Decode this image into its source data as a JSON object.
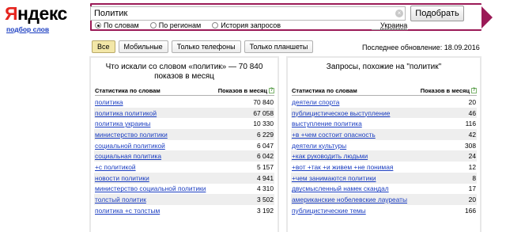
{
  "logo": {
    "first": "Я",
    "rest": "ндекс"
  },
  "subtitle": "подбор слов",
  "search": {
    "value": "Политик",
    "clear_glyph": "×",
    "button": "Подобрать",
    "icon": "close-icon"
  },
  "modes": [
    {
      "label": "По словам",
      "checked": true
    },
    {
      "label": "По регионам",
      "checked": false
    },
    {
      "label": "История запросов",
      "checked": false
    }
  ],
  "region": "Украина",
  "tabs": [
    {
      "label": "Все",
      "active": true
    },
    {
      "label": "Мобильные",
      "active": false
    },
    {
      "label": "Только телефоны",
      "active": false
    },
    {
      "label": "Только планшеты",
      "active": false
    }
  ],
  "updated": "Последнее обновление: 18.09.2016",
  "left_panel": {
    "title": "Что искали со словом «политик» — 70 840 показов в месяц",
    "col_words": "Статистика по словам",
    "col_shows": "Показов в месяц",
    "help_glyph": "?",
    "rows": [
      {
        "kw": "политика",
        "cnt": "70 840"
      },
      {
        "kw": "политика политикой",
        "cnt": "67 058"
      },
      {
        "kw": "политика украины",
        "cnt": "10 330"
      },
      {
        "kw": "министерство политики",
        "cnt": "6 229"
      },
      {
        "kw": "социальной политикой",
        "cnt": "6 047"
      },
      {
        "kw": "социальная политика",
        "cnt": "6 042"
      },
      {
        "kw": "+с политикой",
        "cnt": "5 157"
      },
      {
        "kw": "новости политики",
        "cnt": "4 941"
      },
      {
        "kw": "министерство социальной политики",
        "cnt": "4 310"
      },
      {
        "kw": "толстый политик",
        "cnt": "3 502"
      },
      {
        "kw": "политика +с толстым",
        "cnt": "3 192"
      }
    ]
  },
  "right_panel": {
    "title": "Запросы, похожие на \"политик\"",
    "col_words": "Статистика по словам",
    "col_shows": "Показов в месяц",
    "help_glyph": "?",
    "rows": [
      {
        "kw": "деятели спорта",
        "cnt": "20"
      },
      {
        "kw": "публицистическое выступление",
        "cnt": "46"
      },
      {
        "kw": "выступление политика",
        "cnt": "116"
      },
      {
        "kw": "+в +чем состоит опасность",
        "cnt": "42"
      },
      {
        "kw": "деятели культуры",
        "cnt": "308"
      },
      {
        "kw": "+как руководить людьми",
        "cnt": "24"
      },
      {
        "kw": "+вот +так +и живем +не понимая",
        "cnt": "12"
      },
      {
        "kw": "+чем занимаются политики",
        "cnt": "8"
      },
      {
        "kw": "двусмысленный намек скандал",
        "cnt": "17"
      },
      {
        "kw": "американские нобелевские лауреаты",
        "cnt": "20"
      },
      {
        "kw": "публицистические темы",
        "cnt": "166"
      }
    ]
  }
}
